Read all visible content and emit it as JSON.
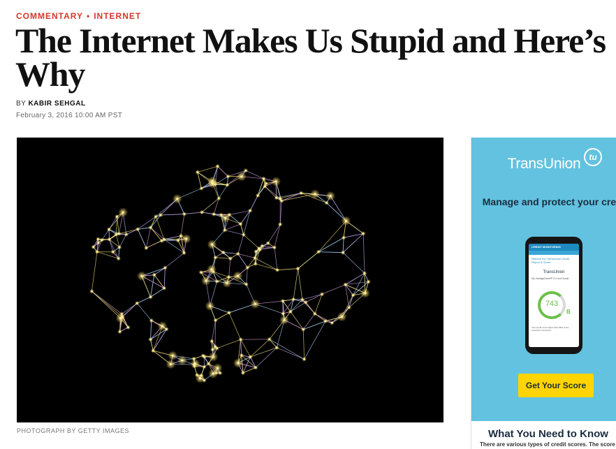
{
  "kicker": {
    "section": "COMMENTARY",
    "separator": "•",
    "topic": "INTERNET"
  },
  "article": {
    "headline": "The Internet Makes Us Stupid and Here’s Why",
    "by_label": "BY",
    "author": "KABIR SEHGAL",
    "date": "February 3, 2016 10:00 AM PST",
    "photo_caption": "PHOTOGRAPH BY GETTY IMAGES"
  },
  "ad": {
    "brand": "TransUnion",
    "logo_text": "tu",
    "tagline": "Manage and protect your credit",
    "phone_header": "CREDIT MONITORING",
    "phone_link": "Refresh my TransUnion Credit Report & Score",
    "phone_brand": "TransUnion",
    "phone_prompt": "My VantageScore® 3.0 and Grade",
    "score": "743",
    "grade": "B",
    "phone_footer": "Your credit score higher than 56% of the American consumers",
    "cta": "Get Your Score",
    "section_heading": "What You Need to Know",
    "section_body": "There are various types of credit scores. The score",
    "colors": {
      "background": "#62c2e0",
      "button": "#ffd400",
      "score": "#6cc04a"
    }
  }
}
